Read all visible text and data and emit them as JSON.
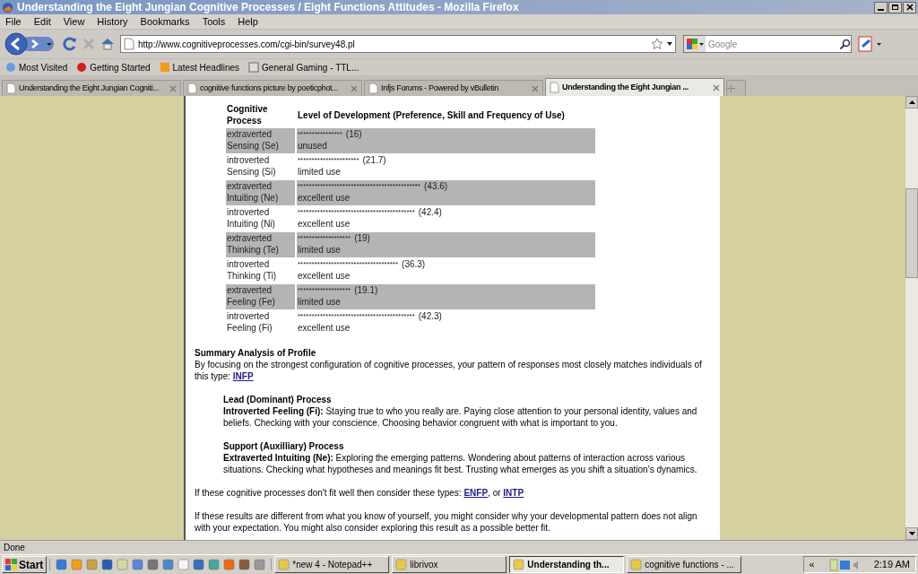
{
  "window": {
    "title": "Understanding the Eight Jungian Cognitive Processes / Eight Functions Attitudes - Mozilla Firefox"
  },
  "menu": [
    "File",
    "Edit",
    "View",
    "History",
    "Bookmarks",
    "Tools",
    "Help"
  ],
  "nav": {
    "url": "http://www.cognitiveprocesses.com/cgi-bin/survey48.pl",
    "search_placeholder": "Google"
  },
  "bookmarks": [
    "Most Visited",
    "Getting Started",
    "Latest Headlines",
    "General Gaming - TTL..."
  ],
  "tabs": [
    {
      "label": "Understanding the Eight Jungian Cogniti...",
      "selected": false
    },
    {
      "label": "cognitive functions picture by poeticphot...",
      "selected": false
    },
    {
      "label": "Infjs Forums - Powered by vBulletin",
      "selected": false
    },
    {
      "label": "Understanding the Eight Jungian ...",
      "selected": true
    }
  ],
  "table": {
    "columns": [
      "Cognitive Process",
      "Level of Development (Preference, Skill and Frequency of Use)"
    ],
    "rows": [
      {
        "attitude": "extraverted",
        "process": "Sensing (Se)",
        "stars": "****************",
        "score": "(16)",
        "rating": "unused",
        "highlighted": true
      },
      {
        "attitude": "introverted",
        "process": "Sensing (Si)",
        "stars": "**********************",
        "score": "(21.7)",
        "rating": "limited use",
        "highlighted": false
      },
      {
        "attitude": "extraverted",
        "process": "Intuiting (Ne)",
        "stars": "********************************************",
        "score": "(43.6)",
        "rating": "excellent use",
        "highlighted": true
      },
      {
        "attitude": "introverted",
        "process": "Intuiting (Ni)",
        "stars": "******************************************",
        "score": "(42.4)",
        "rating": "excellent use",
        "highlighted": false
      },
      {
        "attitude": "extraverted",
        "process": "Thinking (Te)",
        "stars": "*******************",
        "score": "(19)",
        "rating": "limited use",
        "highlighted": true
      },
      {
        "attitude": "introverted",
        "process": "Thinking (Ti)",
        "stars": "************************************",
        "score": "(36.3)",
        "rating": "excellent use",
        "highlighted": false
      },
      {
        "attitude": "extraverted",
        "process": "Feeling (Fe)",
        "stars": "*******************",
        "score": "(19.1)",
        "rating": "limited use",
        "highlighted": true
      },
      {
        "attitude": "introverted",
        "process": "Feeling (Fi)",
        "stars": "******************************************",
        "score": "(42.3)",
        "rating": "excellent use",
        "highlighted": false
      }
    ]
  },
  "summary": {
    "heading": "Summary Analysis of Profile",
    "text": "By focusing on the strongest configuration of cognitive processes, your pattern of responses most closely matches individuals of this type:",
    "link": "INFP"
  },
  "processes": [
    {
      "heading": "Lead (Dominant) Process",
      "text": "**Introverted Feeling (Fi):** Staying true to who you really are. Paying close attention to your personal identity, values and beliefs. Checking with your conscience. Choosing behavior congruent with what is important to you."
    },
    {
      "heading": "Support (Auxilliary) Process",
      "text": "**Extraverted Intuiting (Ne):** Exploring the emerging patterns. Wondering about patterns of interaction across various situations. Checking what hypotheses and meanings fit best. Trusting what emerges as you shift a situation’s dynamics."
    }
  ],
  "alternatives": [
    {
      "kind": "text",
      "text": "If these cognitive processes don't fit well then consider these types:"
    },
    {
      "kind": "link",
      "text": "ENFP"
    },
    {
      "kind": "text",
      "text": ", or"
    },
    {
      "kind": "link",
      "text": "INTP"
    }
  ],
  "closing": "If these results are different from what you know of yourself, you might consider why your developmental pattern does not align with your expectation. You might also consider exploring this result as a possible better fit.",
  "status_bar": "Done",
  "taskbar": {
    "start": "Start",
    "tasks": [
      {
        "label": "*new 4 - Notepad++",
        "selected": false
      },
      {
        "label": "librivox",
        "selected": false
      },
      {
        "label": "Understanding th...",
        "selected": true
      },
      {
        "label": "cognitive functions - ...",
        "selected": false
      }
    ],
    "tray_toggle": "«",
    "clock": "2:19 AM"
  }
}
